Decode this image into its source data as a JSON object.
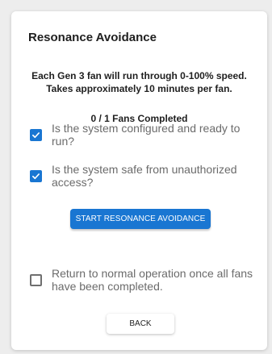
{
  "dialog": {
    "title": "Resonance Avoidance",
    "description_line1": "Each Gen 3 fan will run through 0-100% speed.",
    "description_line2": "Takes approximately 10 minutes per fan.",
    "progress_text": "0 / 1 Fans Completed",
    "checks": [
      {
        "label": "Is the system configured and ready to run?",
        "checked": true
      },
      {
        "label": "Is the system safe from unauthorized access?",
        "checked": true
      }
    ],
    "start_button_label": "START RESONANCE AVOIDANCE",
    "return_option": {
      "label": "Return to normal operation once all fans have been completed.",
      "checked": false
    },
    "back_button_label": "BACK"
  },
  "colors": {
    "accent": "#1976d2",
    "label_gray": "#6b6b6b",
    "background": "#ededed"
  },
  "icons": {
    "checked": "check-icon"
  }
}
